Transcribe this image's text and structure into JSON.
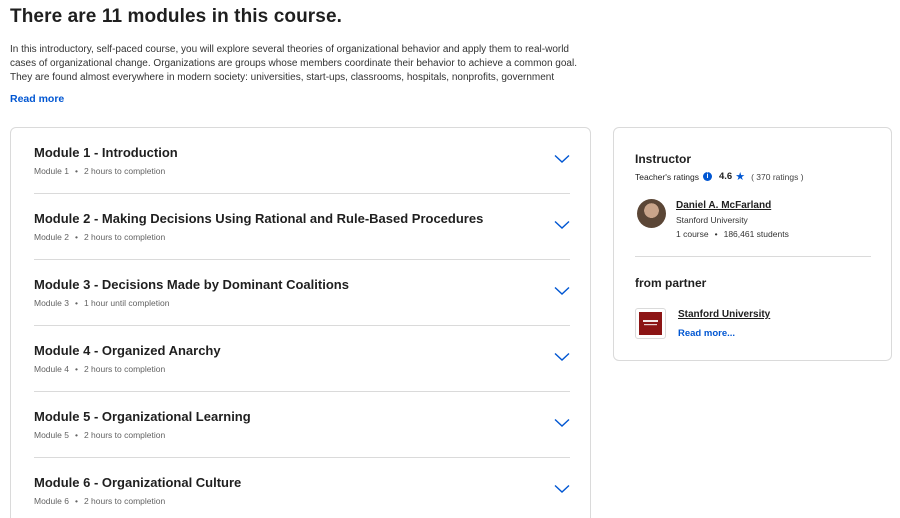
{
  "header": {
    "title": "There are 11 modules in this course.",
    "description": "In this introductory, self-paced course, you will explore several theories of organizational behavior and apply them to real-world cases of organizational change. Organizations are groups whose members coordinate their behavior to achieve a common goal. They are found almost everywhere in modern society: universities, start-ups, classrooms, hospitals, nonprofits, government agencies,",
    "read_more": "Read more"
  },
  "modules": [
    {
      "title": "Module 1 - Introduction",
      "label": "Module 1",
      "duration": "2 hours to completion"
    },
    {
      "title": "Module 2 - Making Decisions Using Rational and Rule-Based Procedures",
      "label": "Module 2",
      "duration": "2 hours to completion"
    },
    {
      "title": "Module 3 - Decisions Made by Dominant Coalitions",
      "label": "Module 3",
      "duration": "1 hour until completion"
    },
    {
      "title": "Module 4 - Organized Anarchy",
      "label": "Module 4",
      "duration": "2 hours to completion"
    },
    {
      "title": "Module 5 - Organizational Learning",
      "label": "Module 5",
      "duration": "2 hours to completion"
    },
    {
      "title": "Module 6 - Organizational Culture",
      "label": "Module 6",
      "duration": "2 hours to completion"
    }
  ],
  "sidebar": {
    "instructor_heading": "Instructor",
    "teacher_ratings_label": "Teacher's ratings",
    "rating_value": "4.6",
    "rating_count": "( 370 ratings )",
    "instructor_name": "Daniel A. McFarland",
    "instructor_org": "Stanford University",
    "instructor_courses": "1 course",
    "instructor_students": "186,461 students",
    "partner_heading": "from partner",
    "partner_name": "Stanford University",
    "partner_logo_text": "Stanford University",
    "partner_read_more": "Read more..."
  },
  "icons": {
    "chevron": "chevron-down-icon",
    "info": "info-icon",
    "star": "star-icon"
  },
  "colors": {
    "accent": "#0056d2",
    "partner_brand": "#8c1515",
    "border": "#dadada"
  }
}
